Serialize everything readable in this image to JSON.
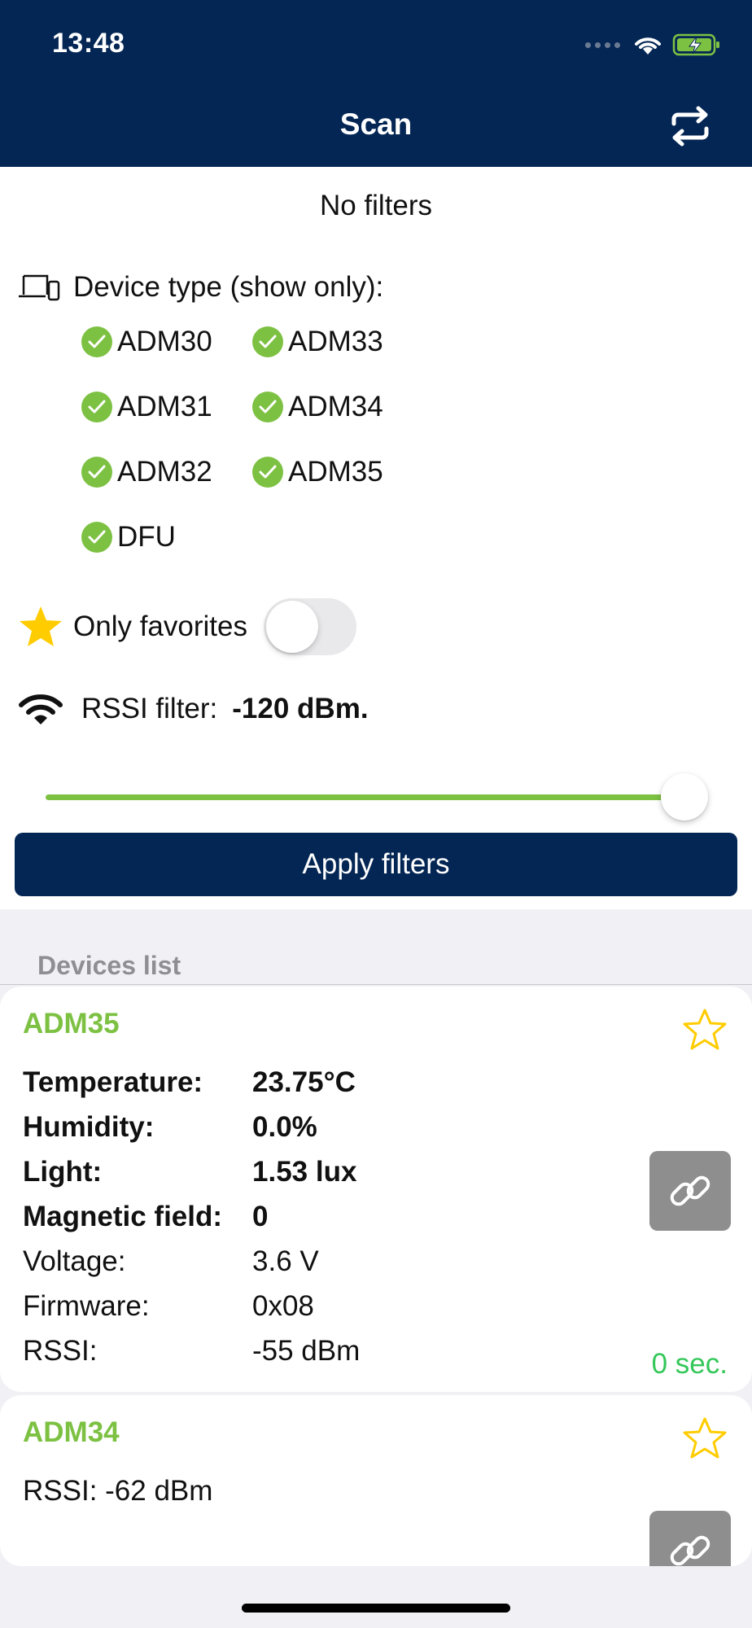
{
  "status_bar": {
    "time": "13:48"
  },
  "nav": {
    "title": "Scan"
  },
  "filters": {
    "header": "No filters",
    "device_type_label": "Device type (show only):",
    "device_types": [
      {
        "label": "ADM30",
        "checked": true
      },
      {
        "label": "ADM33",
        "checked": true
      },
      {
        "label": "ADM31",
        "checked": true
      },
      {
        "label": "ADM34",
        "checked": true
      },
      {
        "label": "ADM32",
        "checked": true
      },
      {
        "label": "ADM35",
        "checked": true
      },
      {
        "label": "DFU",
        "checked": true
      }
    ],
    "favorites_label": "Only favorites",
    "favorites_on": false,
    "rssi_label": "RSSI filter:",
    "rssi_value": "-120 dBm.",
    "rssi_slider_fraction": 1.0,
    "apply_label": "Apply filters"
  },
  "devices": {
    "section_title": "Devices list",
    "items": [
      {
        "name": "ADM35",
        "properties": [
          {
            "key": "Temperature:",
            "value": "23.75°C",
            "bold": true
          },
          {
            "key": "Humidity:",
            "value": "0.0%",
            "bold": true
          },
          {
            "key": "Light:",
            "value": "1.53 lux",
            "bold": true
          },
          {
            "key": "Magnetic field:",
            "value": "0",
            "bold": true
          },
          {
            "key": "Voltage:",
            "value": "3.6 V",
            "bold": false
          },
          {
            "key": "Firmware:",
            "value": "0x08",
            "bold": false
          },
          {
            "key": "RSSI:",
            "value": "-55 dBm",
            "bold": false
          }
        ],
        "elapsed": "0 sec."
      },
      {
        "name": "ADM34",
        "rssi_text": "RSSI:  -62 dBm"
      }
    ]
  },
  "colors": {
    "navy": "#042654",
    "green": "#7dc143",
    "elapsed_green": "#34c759",
    "star_yellow": "#ffcc00",
    "link_gray": "#8e8e8e"
  }
}
